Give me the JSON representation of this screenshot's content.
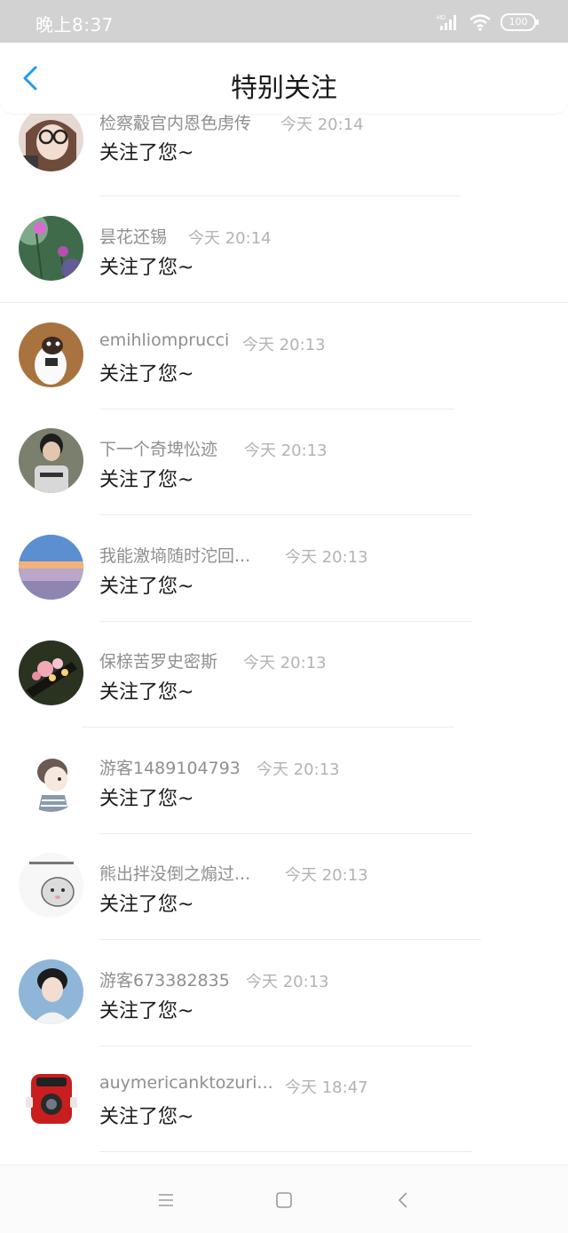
{
  "status_bar": {
    "time": "晚上8:37",
    "battery": "100"
  },
  "header": {
    "title": "特别关注"
  },
  "items": [
    {
      "name": "检察觳官内恩色虏传",
      "time": "今天 20:14",
      "action": "关注了您~"
    },
    {
      "name": "昙花还锡",
      "time": "今天 20:14",
      "action": "关注了您~"
    },
    {
      "name": "emihliomprucci",
      "time": "今天 20:13",
      "action": "关注了您~"
    },
    {
      "name": "下一个奇埤忪迹",
      "time": "今天 20:13",
      "action": "关注了您~"
    },
    {
      "name": "我能激墒随时沱回...",
      "time": "今天 20:13",
      "action": "关注了您~"
    },
    {
      "name": "保榇苦罗史密斯",
      "time": "今天 20:13",
      "action": "关注了您~"
    },
    {
      "name": "游客1489104793",
      "time": "今天 20:13",
      "action": "关注了您~"
    },
    {
      "name": "熊出拌没倒之煽过...",
      "time": "今天 20:13",
      "action": "关注了您~"
    },
    {
      "name": "游客673382835",
      "time": "今天 20:13",
      "action": "关注了您~"
    },
    {
      "name": "auymericanktozuri...",
      "time": "今天 18:47",
      "action": "关注了您~"
    }
  ],
  "colors": {
    "accent": "#1e9bf0",
    "title": "#1a1a1a",
    "name": "#8f8f8f",
    "time": "#b3b3b3"
  },
  "icons": [
    "signal-icon",
    "wifi-icon",
    "battery-icon",
    "back-arrow-icon",
    "menu-icon",
    "home-icon",
    "nav-back-icon"
  ]
}
